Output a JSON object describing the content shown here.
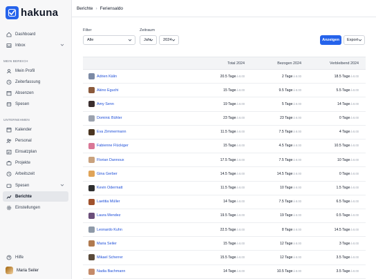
{
  "app": {
    "name": "hakuna"
  },
  "sidebar": {
    "top_items": [
      {
        "label": "Dashboard",
        "icon": "home-icon"
      },
      {
        "label": "Inbox",
        "icon": "inbox-icon"
      }
    ],
    "sections": [
      {
        "label": "MEIN BEREICH",
        "items": [
          {
            "label": "Mein Profil",
            "icon": "user-icon"
          },
          {
            "label": "Zeiterfassung",
            "icon": "clock-icon"
          },
          {
            "label": "Absenzen",
            "icon": "calendar-x-icon"
          },
          {
            "label": "Spesen",
            "icon": "receipt-icon"
          }
        ]
      },
      {
        "label": "UNTERNEHMEN",
        "items": [
          {
            "label": "Kalender",
            "icon": "calendar-icon"
          },
          {
            "label": "Personal",
            "icon": "users-icon"
          },
          {
            "label": "Einsatzplan",
            "icon": "schedule-icon"
          },
          {
            "label": "Projekte",
            "icon": "briefcase-icon"
          },
          {
            "label": "Arbeitszeit",
            "icon": "clock-icon"
          },
          {
            "label": "Spesen",
            "icon": "wallet-icon"
          },
          {
            "label": "Berichte",
            "icon": "chart-icon"
          },
          {
            "label": "Einstellungen",
            "icon": "gear-icon"
          }
        ]
      }
    ],
    "help_label": "Hilfe",
    "user_name": "Maria Seiler"
  },
  "breadcrumb": {
    "parent": "Berichte",
    "current": "Feriensaldo"
  },
  "filters": {
    "filter_label": "Filter",
    "filter_value": "Alle",
    "period_label": "Zeitraum",
    "period_unit": "Jahr",
    "period_year": "2024",
    "apply_label": "Anzeigen",
    "export_label": "Export"
  },
  "table": {
    "columns": [
      "Total 2024",
      "Bezogen 2024",
      "Verbleibend 2024"
    ],
    "day_unit": "Tage",
    "hour_hint": "à 8.00",
    "rows": [
      {
        "name": "Adrien Kälin",
        "total": "20.5",
        "used": "2",
        "remaining": "18.5",
        "avatar_color": "#7c8aa5"
      },
      {
        "name": "Akino Eguchi",
        "total": "15",
        "used": "9.5",
        "remaining": "5.5",
        "avatar_color": "#8b5a3c"
      },
      {
        "name": "Amy Senn",
        "total": "19",
        "used": "5",
        "remaining": "14",
        "avatar_color": "#3b2f2f"
      },
      {
        "name": "Dominic Bühler",
        "total": "23",
        "used": "23",
        "remaining": "0",
        "avatar_color": "#9ca3af"
      },
      {
        "name": "Eva Zimmermann",
        "total": "11.5",
        "used": "7.5",
        "remaining": "4",
        "avatar_color": "#4b3621"
      },
      {
        "name": "Fabienne Flückiger",
        "total": "15",
        "used": "4.5",
        "remaining": "10.5",
        "avatar_color": "#d97796"
      },
      {
        "name": "Florian Dannoux",
        "total": "17.5",
        "used": "7.5",
        "remaining": "10",
        "avatar_color": "#c9a27e"
      },
      {
        "name": "Gina Gerber",
        "total": "14.5",
        "used": "14.5",
        "remaining": "0",
        "avatar_color": "#e0a458"
      },
      {
        "name": "Kevin Odermatt",
        "total": "11.5",
        "used": "10",
        "remaining": "1.5",
        "avatar_color": "#2f2f2f"
      },
      {
        "name": "Laetitia Müller",
        "total": "14",
        "used": "7.5",
        "remaining": "6.5",
        "avatar_color": "#a0522d"
      },
      {
        "name": "Laura Mendez",
        "total": "19.5",
        "used": "19",
        "remaining": "0.5",
        "avatar_color": "#6b4f7a"
      },
      {
        "name": "Leonardo Kuhn",
        "total": "22.5",
        "used": "8",
        "remaining": "14.5",
        "avatar_color": "#8f9aa8"
      },
      {
        "name": "Maria Seiler",
        "total": "15",
        "used": "12",
        "remaining": "3",
        "avatar_color": "#b07a4f"
      },
      {
        "name": "Mikael Scherrer",
        "total": "15.5",
        "used": "12",
        "remaining": "3.5",
        "avatar_color": "#5a4a3a"
      },
      {
        "name": "Nadia Bachmann",
        "total": "14",
        "used": "10.5",
        "remaining": "3.5",
        "avatar_color": "#c48b6a"
      }
    ]
  },
  "colors": {
    "accent": "#2563eb",
    "link": "#1d4ed8"
  }
}
